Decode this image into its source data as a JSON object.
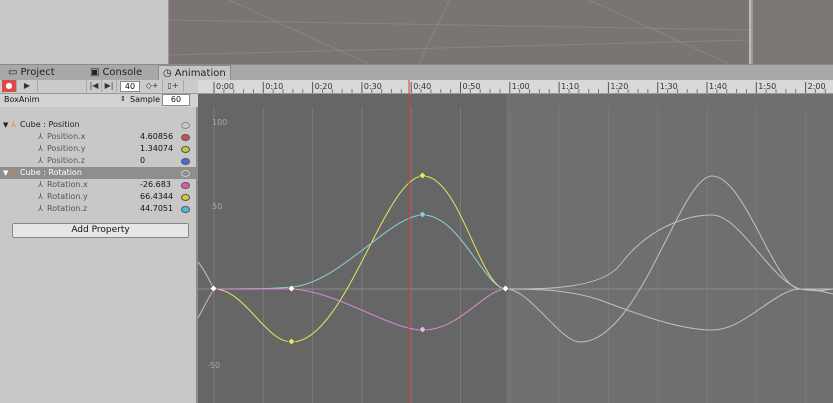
{
  "tabs": [
    {
      "label": "Project",
      "icon": "folder-icon"
    },
    {
      "label": "Console",
      "icon": "console-icon"
    },
    {
      "label": "Animation",
      "icon": "clock-icon"
    }
  ],
  "toolbar": {
    "frame": "40"
  },
  "clip": {
    "name": "BoxAnim",
    "sample_label": "Sample",
    "sample_value": "60"
  },
  "groups": [
    {
      "label": "Cube : Position",
      "props": [
        {
          "label": "Position.x",
          "value": "4.60856",
          "color": "#d84b4b"
        },
        {
          "label": "Position.y",
          "value": "1.34074",
          "color": "#c8c832"
        },
        {
          "label": "Position.z",
          "value": "0",
          "color": "#4b6ad8"
        }
      ]
    },
    {
      "label": "Cube : Rotation",
      "props": [
        {
          "label": "Rotation.x",
          "value": "-26.683",
          "color": "#d85ab4"
        },
        {
          "label": "Rotation.y",
          "value": "66.4344",
          "color": "#d8c832"
        },
        {
          "label": "Rotation.z",
          "value": "44.7051",
          "color": "#4bbfd8"
        }
      ]
    }
  ],
  "add_property_label": "Add Property",
  "ruler_ticks": [
    "0:00",
    "0:10",
    "0:20",
    "0:30",
    "0:40",
    "0:50",
    "1:00",
    "1:10",
    "1:20",
    "1:30",
    "1:40",
    "1:50",
    "2:00"
  ],
  "y_labels": [
    "100",
    "50",
    "-50"
  ],
  "curves": {
    "yellow": "#e6e65a",
    "cyan": "#8ad0dc",
    "magenta": "#d88ad0",
    "ghost": "#d0d0d0",
    "playhead": "#d23c3c"
  }
}
